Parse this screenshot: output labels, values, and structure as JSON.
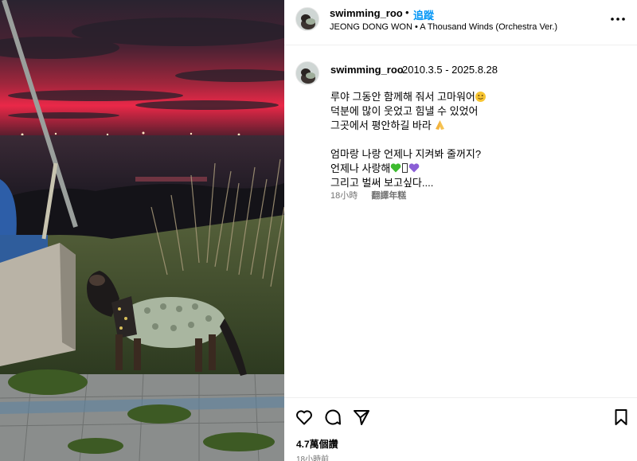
{
  "header": {
    "username": "swimming_roo",
    "separator": "•",
    "follow_label": "追蹤",
    "audio": "JEONG DONG WON • A Thousand Winds (Orchestra Ver.)"
  },
  "caption": {
    "username": "swimming_roo",
    "dates": "2010.3.5 - 2025.8.28",
    "line1": "루야 그동안 함께해 줘서 고마워어",
    "line2": "덕분에 많이 웃었고 힘낼 수 있었어",
    "line3": "그곳에서 평안하길 바라",
    "line4": "엄마랑 나랑 언제나 지켜봐 줄꺼지?",
    "line5": "언제나 사랑해",
    "line6": "그리고 벌써 보고싶다....",
    "time": "18小時",
    "translate_label": "翻譯年糕"
  },
  "footer": {
    "likes": "4.7萬個讚",
    "time": "18小時前"
  },
  "icons": {
    "more": "more-horizontal-icon",
    "like": "heart-icon",
    "comment": "comment-icon",
    "share": "send-icon",
    "save": "bookmark-icon"
  },
  "colors": {
    "link_blue": "#0095f6",
    "muted_text": "#737373",
    "sunset_red": "#e0283f",
    "dog_shirt": "#a9b6a0"
  }
}
